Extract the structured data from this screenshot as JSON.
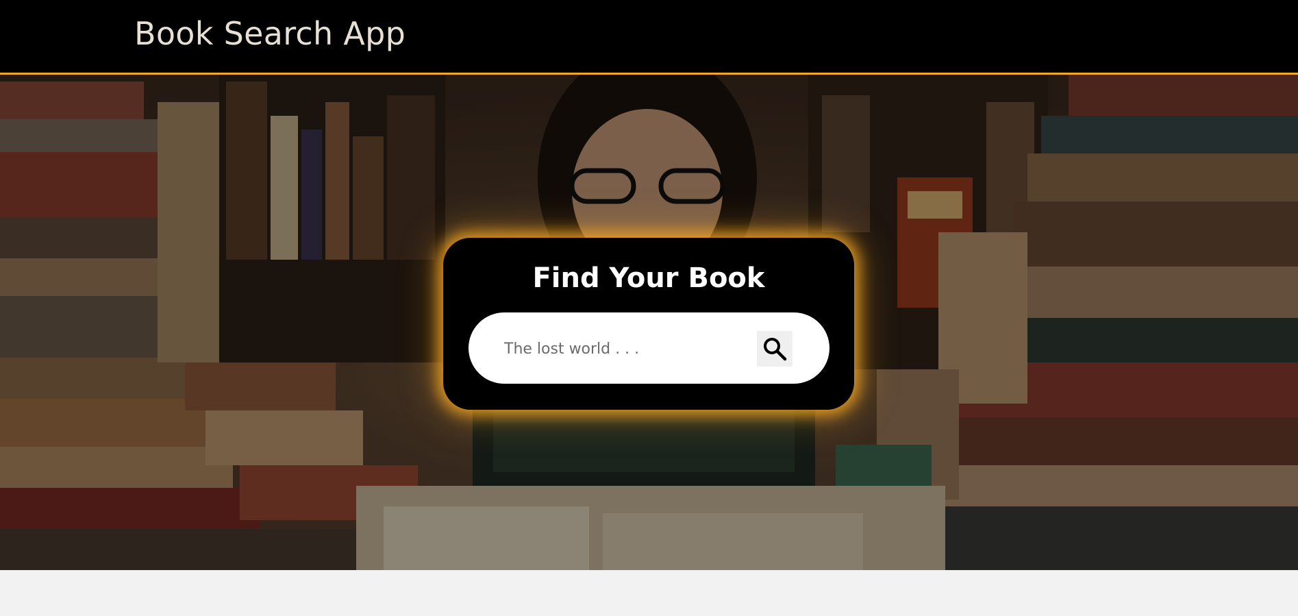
{
  "header": {
    "title": "Book Search App"
  },
  "search_card": {
    "title": "Find Your Book",
    "input_value": "",
    "input_placeholder": "The lost world . . ."
  },
  "icons": {
    "search_button": "search-icon"
  },
  "colors": {
    "accent": "#f5a623",
    "navbar_bg": "#000000",
    "card_bg": "#000000",
    "page_bg": "#f2f2f2"
  }
}
